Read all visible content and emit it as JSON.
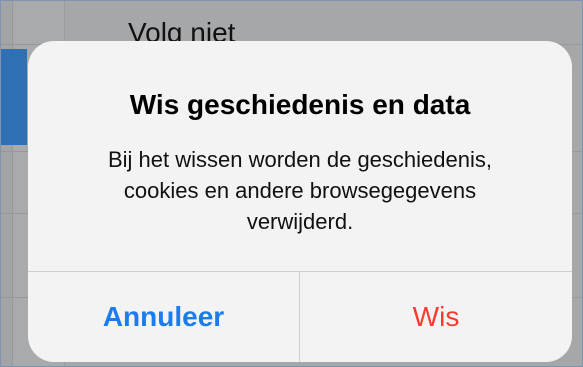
{
  "background": {
    "row_label": "Volg niet"
  },
  "alert": {
    "title": "Wis geschiedenis en data",
    "message_lines": [
      "Bij het wissen worden de geschiedenis,",
      "cookies en andere browsegegevens",
      "verwijderd."
    ],
    "buttons": {
      "cancel_label": "Annuleer",
      "delete_label": "Wis"
    }
  },
  "colors": {
    "cancel_button": "#1b7cf0",
    "delete_button": "#fb3b30",
    "alert_background": "#f3f3f4",
    "overlay_dim": "#a6a7a9",
    "selected_row": "#2f6fb3"
  }
}
